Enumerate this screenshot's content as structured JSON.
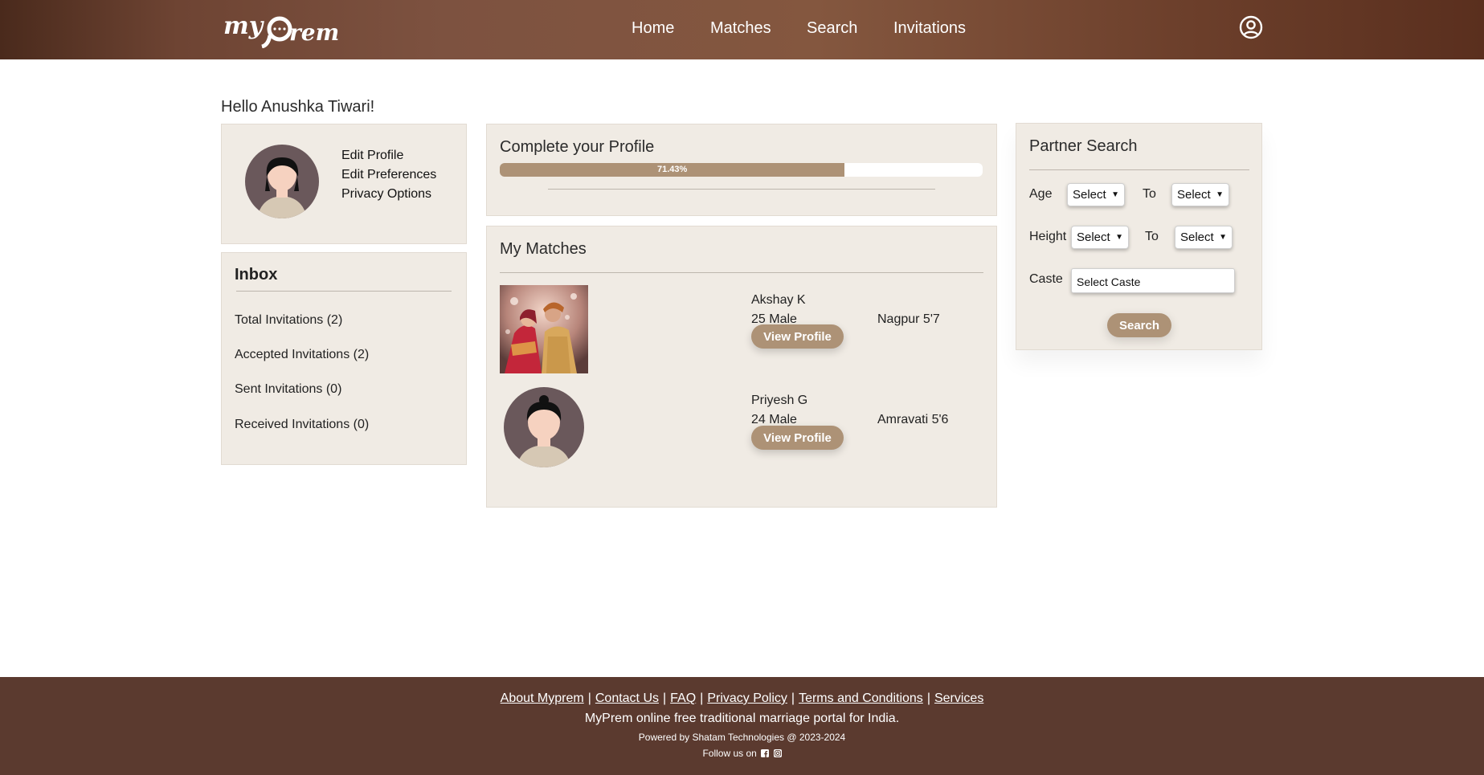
{
  "brand": {
    "logo_text": "myPrem"
  },
  "nav": {
    "items": [
      "Home",
      "Matches",
      "Search",
      "Invitations"
    ]
  },
  "greeting": "Hello Anushka Tiwari!",
  "profile_links": [
    "Edit Profile",
    "Edit Preferences",
    "Privacy Options"
  ],
  "inbox": {
    "title": "Inbox",
    "items": [
      "Total Invitations (2)",
      "Accepted Invitations (2)",
      "Sent Invitations (0)",
      "Received Invitations (0)"
    ]
  },
  "complete_profile": {
    "title": "Complete your Profile",
    "progress_label": "71.43%",
    "progress_value": 71.43
  },
  "matches": {
    "title": "My Matches",
    "items": [
      {
        "name": "Akshay K",
        "age_sex": "25 Male",
        "location_height": "Nagpur 5'7",
        "button": "View Profile",
        "photo": "couple-photo"
      },
      {
        "name": "Priyesh G",
        "age_sex": "24 Male",
        "location_height": "Amravati 5'6",
        "button": "View Profile",
        "photo": "avatar-icon"
      }
    ]
  },
  "partner_search": {
    "title": "Partner Search",
    "age_label": "Age",
    "height_label": "Height",
    "to_label": "To",
    "caste_label": "Caste",
    "select_value": "Select",
    "caste_value": "Select Caste",
    "button": "Search"
  },
  "footer": {
    "links": [
      "About Myprem",
      "Contact Us",
      "FAQ",
      "Privacy Policy",
      "Terms and Conditions",
      "Services"
    ],
    "tagline": "MyPrem online free traditional marriage portal for India.",
    "powered": "Powered by Shatam Technologies @ 2023-2024",
    "follow": "Follow us on"
  },
  "colors": {
    "header": "#7d5240",
    "accent": "#ad9276",
    "panel": "#f0ebe4",
    "footer": "#5b3a2f"
  }
}
